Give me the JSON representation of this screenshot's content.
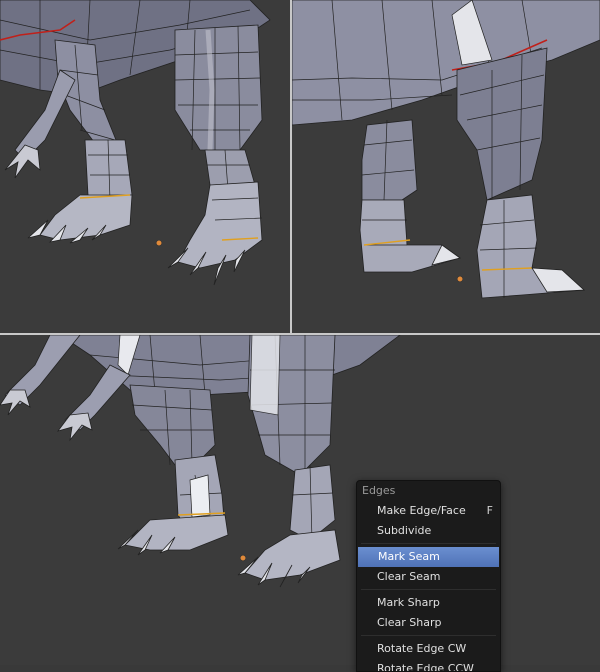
{
  "menu": {
    "title": "Edges",
    "items": [
      {
        "label": "Make Edge/Face",
        "shortcut": "F"
      },
      {
        "label": "Subdivide"
      },
      {
        "label": "Mark Seam"
      },
      {
        "label": "Clear Seam"
      },
      {
        "label": "Mark Sharp"
      },
      {
        "label": "Clear Sharp"
      },
      {
        "label": "Rotate Edge CW"
      },
      {
        "label": "Rotate Edge CCW"
      }
    ],
    "highlighted_index": 2
  },
  "colors": {
    "background": "#3b3b3b",
    "mesh_face": "#8a8c9e",
    "mesh_light": "#d6d7de",
    "mesh_dark": "#5e6070",
    "seam_red": "#c0201a",
    "seam_orange": "#e0a020",
    "cursor_orange": "#e08a3a",
    "menu_bg": "#1b1b1b",
    "menu_highlight": "#5b80c4"
  }
}
